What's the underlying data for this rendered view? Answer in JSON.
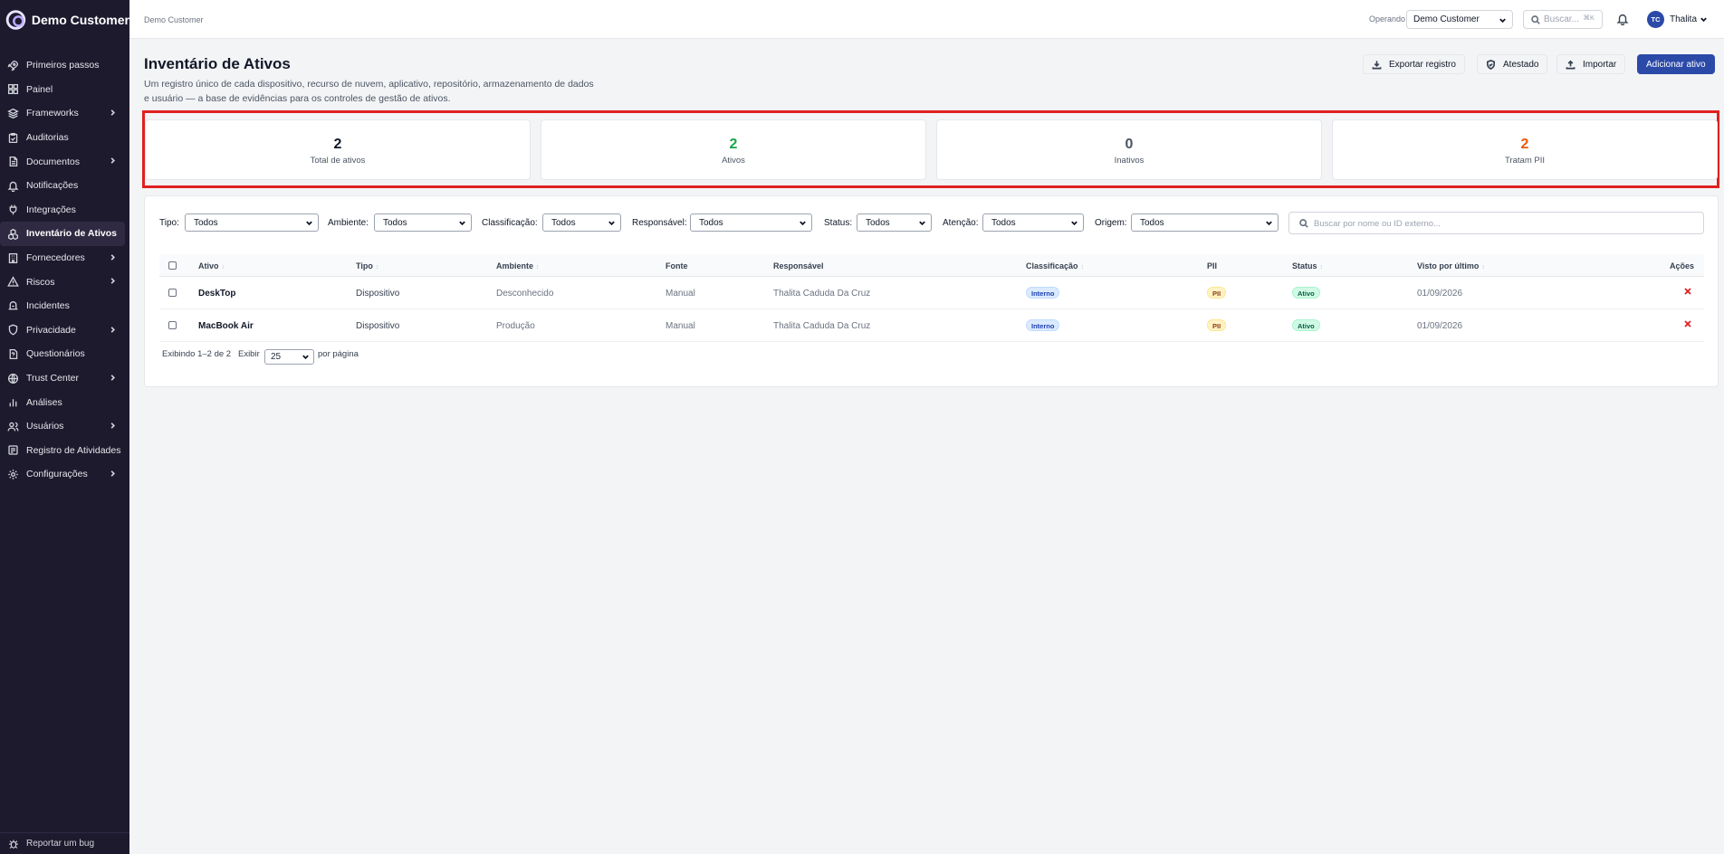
{
  "brand": {
    "name": "Demo Customer"
  },
  "sidebar": {
    "items": [
      {
        "label": "Primeiros passos",
        "icon": "rocket-icon",
        "chevron": false
      },
      {
        "label": "Painel",
        "icon": "dashboard-icon",
        "chevron": false
      },
      {
        "label": "Frameworks",
        "icon": "layers-icon",
        "chevron": true
      },
      {
        "label": "Auditorias",
        "icon": "clipboard-check-icon",
        "chevron": false
      },
      {
        "label": "Documentos",
        "icon": "document-icon",
        "chevron": true
      },
      {
        "label": "Notificações",
        "icon": "bell-icon",
        "chevron": false
      },
      {
        "label": "Integrações",
        "icon": "plug-icon",
        "chevron": false
      },
      {
        "label": "Inventário de Ativos",
        "icon": "boxes-icon",
        "chevron": false,
        "active": true
      },
      {
        "label": "Fornecedores",
        "icon": "building-icon",
        "chevron": true
      },
      {
        "label": "Riscos",
        "icon": "warning-icon",
        "chevron": true
      },
      {
        "label": "Incidentes",
        "icon": "incident-icon",
        "chevron": false
      },
      {
        "label": "Privacidade",
        "icon": "shield-icon",
        "chevron": true
      },
      {
        "label": "Questionários",
        "icon": "questionnaire-icon",
        "chevron": false
      },
      {
        "label": "Trust Center",
        "icon": "globe-icon",
        "chevron": true
      },
      {
        "label": "Análises",
        "icon": "bar-chart-icon",
        "chevron": false
      },
      {
        "label": "Usuários",
        "icon": "users-icon",
        "chevron": true
      },
      {
        "label": "Registro de Atividades",
        "icon": "activity-log-icon",
        "chevron": false
      },
      {
        "label": "Configurações",
        "icon": "gear-icon",
        "chevron": true
      }
    ],
    "bug_label": "Reportar um bug"
  },
  "topbar": {
    "breadcrumb": "Demo Customer",
    "operating_label": "Operando",
    "operating_value": "Demo Customer",
    "search_placeholder": "Buscar...",
    "search_shortcut": "⌘K",
    "user_initials": "TC",
    "user_name": "Thalita"
  },
  "header": {
    "title": "Inventário de Ativos",
    "description": "Um registro único de cada dispositivo, recurso de nuvem, aplicativo, repositório, armazenamento de dados e usuário — a base de evidências para os controles de gestão de ativos.",
    "buttons": {
      "export": "Exportar registro",
      "attest": "Atestado",
      "import": "Importar",
      "add": "Adicionar ativo"
    }
  },
  "stats": [
    {
      "value": "2",
      "label": "Total de ativos",
      "color": "#111827"
    },
    {
      "value": "2",
      "label": "Ativos",
      "color": "#16a34a"
    },
    {
      "value": "0",
      "label": "Inativos",
      "color": "#4b5563"
    },
    {
      "value": "2",
      "label": "Tratam PII",
      "color": "#ea580c"
    }
  ],
  "filters": [
    {
      "label": "Tipo:",
      "value": "Todos"
    },
    {
      "label": "Ambiente:",
      "value": "Todos"
    },
    {
      "label": "Classificação:",
      "value": "Todos"
    },
    {
      "label": "Responsável:",
      "value": "Todos"
    },
    {
      "label": "Status:",
      "value": "Todos"
    },
    {
      "label": "Atenção:",
      "value": "Todos"
    },
    {
      "label": "Origem:",
      "value": "Todos"
    }
  ],
  "table_search_placeholder": "Buscar por nome ou ID externo...",
  "table": {
    "columns": [
      "Ativo",
      "Tipo",
      "Ambiente",
      "Fonte",
      "Responsável",
      "Classificação",
      "PII",
      "Status",
      "Visto por último",
      "Ações"
    ],
    "rows": [
      {
        "ativo": "DeskTop",
        "tipo": "Dispositivo",
        "ambiente": "Desconhecido",
        "fonte": "Manual",
        "responsavel": "Thalita Caduda Da Cruz",
        "classificacao": "Interno",
        "pii": "PII",
        "status": "Ativo",
        "visto": "01/09/2026"
      },
      {
        "ativo": "MacBook Air",
        "tipo": "Dispositivo",
        "ambiente": "Produção",
        "fonte": "Manual",
        "responsavel": "Thalita Caduda Da Cruz",
        "classificacao": "Interno",
        "pii": "PII",
        "status": "Ativo",
        "visto": "01/09/2026"
      }
    ]
  },
  "pagination": {
    "showing": "Exibindo 1–2 de 2",
    "show_label": "Exibir",
    "page_size": "25",
    "per_page": "por página"
  }
}
